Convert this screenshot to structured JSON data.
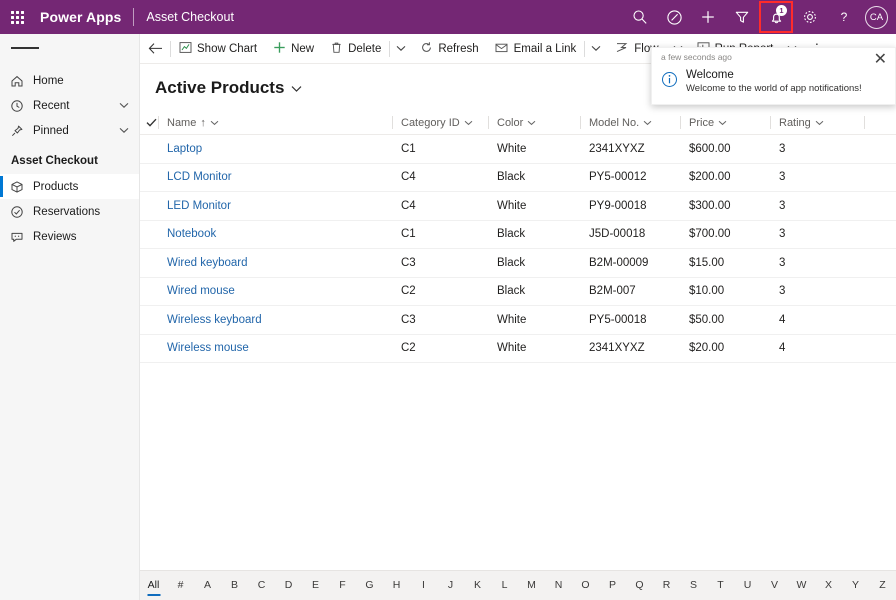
{
  "topbar": {
    "waffle_label": "app-launcher",
    "brand": "Power Apps",
    "app_name": "Asset Checkout",
    "purple": "#742774",
    "icons": [
      "search-icon",
      "compass-icon",
      "plus-icon",
      "filter-icon",
      "bell-icon",
      "gear-icon",
      "help-icon"
    ],
    "notification_count": "1",
    "avatar_initials": "CA",
    "highlight_color": "#ff2b2b"
  },
  "sidebar": {
    "nav": [
      {
        "label": "Home",
        "icon": "home-icon",
        "chevron": false,
        "selected": false
      },
      {
        "label": "Recent",
        "icon": "clock-icon",
        "chevron": true,
        "selected": false
      },
      {
        "label": "Pinned",
        "icon": "pin-icon",
        "chevron": true,
        "selected": false
      }
    ],
    "section_title": "Asset Checkout",
    "items": [
      {
        "label": "Products",
        "icon": "box-icon",
        "selected": true
      },
      {
        "label": "Reservations",
        "icon": "check-circle-icon",
        "selected": false
      },
      {
        "label": "Reviews",
        "icon": "comment-icon",
        "selected": false
      }
    ]
  },
  "commandbar": {
    "back_label": "back-arrow",
    "buttons": [
      {
        "label": "Show Chart",
        "icon": "chart-icon"
      },
      {
        "label": "New",
        "icon": "plus-icon"
      },
      {
        "label": "Delete",
        "icon": "trash-icon"
      },
      {
        "label": "Refresh",
        "icon": "refresh-icon"
      },
      {
        "label": "Email a Link",
        "icon": "email-link-icon"
      },
      {
        "label": "Flow",
        "icon": "flow-icon"
      },
      {
        "label": "Run Report",
        "icon": "report-icon"
      }
    ],
    "overflow_label": "⋮"
  },
  "notification": {
    "time": "a few seconds ago",
    "title": "Welcome",
    "message": "Welcome to the world of app notifications!",
    "close_label": "✕",
    "icon": "info-icon",
    "accent": "#0f6cbd"
  },
  "view": {
    "title": "Active Products"
  },
  "grid": {
    "columns": [
      {
        "label": "Name",
        "sort": "↑"
      },
      {
        "label": "Category ID",
        "sort": ""
      },
      {
        "label": "Color",
        "sort": ""
      },
      {
        "label": "Model No.",
        "sort": ""
      },
      {
        "label": "Price",
        "sort": ""
      },
      {
        "label": "Rating",
        "sort": ""
      }
    ],
    "rows": [
      {
        "name": "Laptop",
        "category": "C1",
        "color": "White",
        "model": "2341XYXZ",
        "price": "$600.00",
        "rating": "3"
      },
      {
        "name": "LCD Monitor",
        "category": "C4",
        "color": "Black",
        "model": "PY5-00012",
        "price": "$200.00",
        "rating": "3"
      },
      {
        "name": "LED Monitor",
        "category": "C4",
        "color": "White",
        "model": "PY9-00018",
        "price": "$300.00",
        "rating": "3"
      },
      {
        "name": "Notebook",
        "category": "C1",
        "color": "Black",
        "model": "J5D-00018",
        "price": "$700.00",
        "rating": "3"
      },
      {
        "name": "Wired keyboard",
        "category": "C3",
        "color": "Black",
        "model": "B2M-00009",
        "price": "$15.00",
        "rating": "3"
      },
      {
        "name": "Wired mouse",
        "category": "C2",
        "color": "Black",
        "model": "B2M-007",
        "price": "$10.00",
        "rating": "3"
      },
      {
        "name": "Wireless keyboard",
        "category": "C3",
        "color": "White",
        "model": "PY5-00018",
        "price": "$50.00",
        "rating": "4"
      },
      {
        "name": "Wireless mouse",
        "category": "C2",
        "color": "White",
        "model": "2341XYXZ",
        "price": "$20.00",
        "rating": "4"
      }
    ]
  },
  "alphabet": {
    "active": "All",
    "items": [
      "All",
      "#",
      "A",
      "B",
      "C",
      "D",
      "E",
      "F",
      "G",
      "H",
      "I",
      "J",
      "K",
      "L",
      "M",
      "N",
      "O",
      "P",
      "Q",
      "R",
      "S",
      "T",
      "U",
      "V",
      "W",
      "X",
      "Y",
      "Z"
    ]
  }
}
